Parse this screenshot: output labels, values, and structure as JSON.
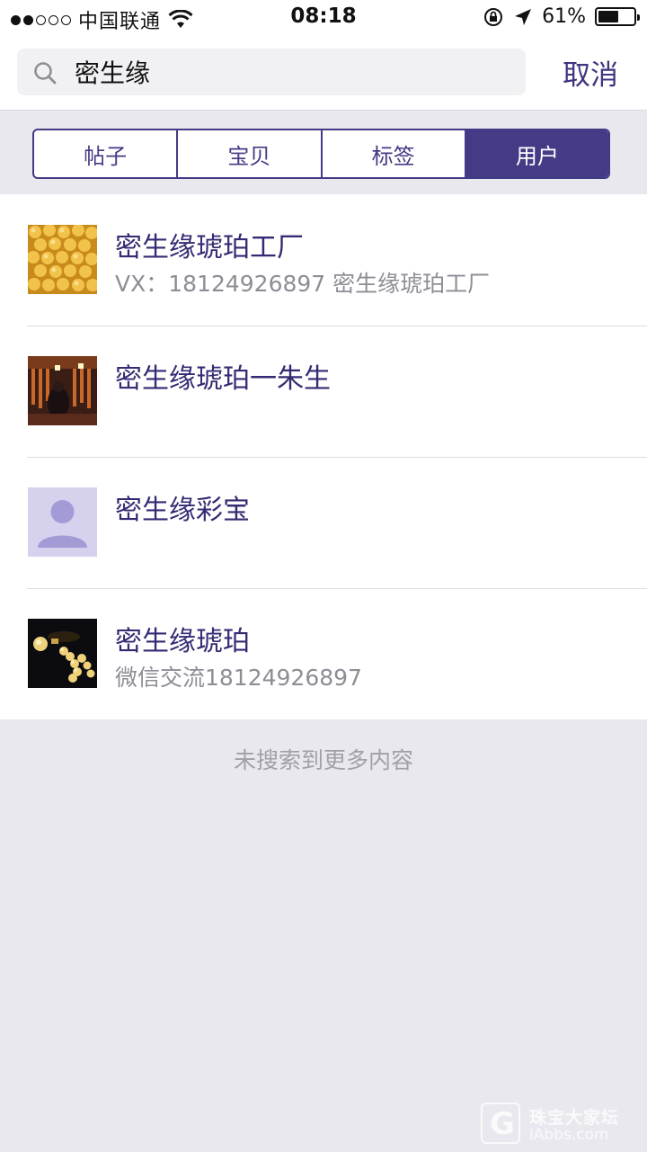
{
  "status_bar": {
    "carrier": "中国联通",
    "time": "08:18",
    "battery": "61%",
    "battery_level": 0.61,
    "signal_bars_filled": 2,
    "signal_bars_total": 5
  },
  "search": {
    "query": "密生缘",
    "cancel_label": "取消"
  },
  "tabs": [
    {
      "label": "帖子",
      "active": false
    },
    {
      "label": "宝贝",
      "active": false
    },
    {
      "label": "标签",
      "active": false
    },
    {
      "label": "用户",
      "active": true
    }
  ],
  "results": [
    {
      "name": "密生缘琥珀工厂",
      "subtitle": "VX：18124926897  密生缘琥珀工厂",
      "avatar": "amber-beads-photo"
    },
    {
      "name": "密生缘琥珀一朱生",
      "subtitle": "",
      "avatar": "amber-shop-photo"
    },
    {
      "name": "密生缘彩宝",
      "subtitle": "",
      "avatar": "default-user-avatar"
    },
    {
      "name": "密生缘琥珀",
      "subtitle": "微信交流18124926897",
      "avatar": "amber-necklace-photo"
    }
  ],
  "footer_text": "未搜索到更多内容",
  "watermark": {
    "title": "珠宝大家坛",
    "url": "iAbbs.com"
  },
  "colors": {
    "accent": "#433b85",
    "name_text": "#332b73",
    "subtitle_text": "#8d8d96",
    "background": "#e8e8ee"
  }
}
